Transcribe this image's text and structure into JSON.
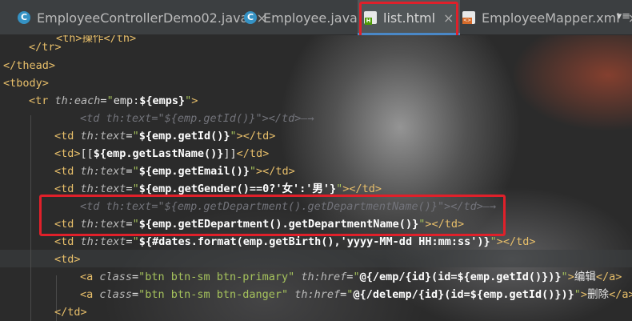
{
  "tabs": [
    {
      "label": "EmployeeControllerDemo02.java",
      "icon": "java-class-icon",
      "closable": true,
      "active": false
    },
    {
      "label": "Employee.java",
      "icon": "java-class-icon",
      "closable": true,
      "active": false
    },
    {
      "label": "list.html",
      "icon": "html-file-icon",
      "closable": true,
      "active": true
    },
    {
      "label": "EmployeeMapper.xml",
      "icon": "xml-file-icon",
      "closable": true,
      "active": false
    }
  ],
  "tab_icon_letter": "C",
  "close_glyph": "×",
  "more_glyph": "▾≡",
  "code": {
    "line_top": "<th>操作</th>",
    "line_tr_close": "</tr>",
    "line_thead_close": "</thead>",
    "line_tbody": "<tbody>",
    "each": {
      "open": "<tr ",
      "attr": "th:each",
      "eq": "=",
      "q1": "\"",
      "val": "emp:",
      "expr": "${emps}",
      "q2": "\"",
      "close": ">"
    },
    "cm_id": "<td th:text=\"${emp.getId()}\"></td>—→",
    "td_id": {
      "open": "<td ",
      "attr": "th:text",
      "eq": "=",
      "q1": "\"",
      "expr": "${emp.getId()}",
      "q2": "\"",
      "close": "></td>"
    },
    "td_last": {
      "open": "<td>",
      "text": "[[",
      "expr": "${emp.getLastName()}",
      "text2": "]]",
      "close": "</td>"
    },
    "td_email": {
      "open": "<td ",
      "attr": "th:text",
      "eq": "=",
      "q1": "\"",
      "expr": "${emp.getEmail()}",
      "q2": "\"",
      "close": "></td>"
    },
    "td_gender": {
      "open": "<td ",
      "attr": "th:text",
      "eq": "=",
      "q1": "\"",
      "expr": "${emp.getGender()==0?'女':'男'}",
      "q2": "\"",
      "close": "></td>"
    },
    "cm_dept": "<td th:text=\"${emp.getDepartment().getDepartmentName()}\"></td>—→",
    "td_dept": {
      "open": "<td ",
      "attr": "th:text",
      "eq": "=",
      "q1": "\"",
      "expr": "${emp.getEDepartment().getDepartmentName()}",
      "q2": "\"",
      "close": "></td>"
    },
    "td_birth": {
      "open": "<td ",
      "attr": "th:text",
      "eq": "=",
      "q1": "\"",
      "expr": "${#dates.format(emp.getBirth(),'yyyy-MM-dd HH:mm:ss')}",
      "q2": "\"",
      "close": "></td>"
    },
    "td_open": "<td>",
    "a_edit": {
      "open": "<a ",
      "cls_attr": "class",
      "eq": "=",
      "cls_val": "\"btn btn-sm btn-primary\"",
      "href_attr": "th:href",
      "eq2": "=",
      "q1": "\"",
      "expr": "@{/emp/{id}(id=${emp.getId()})}",
      "q2": "\"",
      "gt": ">",
      "text": "编辑",
      "close": "</a>"
    },
    "a_del": {
      "open": "<a ",
      "cls_attr": "class",
      "eq": "=",
      "cls_val": "\"btn btn-sm btn-danger\"",
      "href_attr": "th:href",
      "eq2": "=",
      "q1": "\"",
      "expr": "@{/delemp/{id}(id=${emp.getId()})}",
      "q2": "\"",
      "gt": ">",
      "text": "删除",
      "close": "</a>"
    },
    "td_close": "</td>"
  },
  "colors": {
    "highlight_box": "#e0202a",
    "tag": "#e8bf6a",
    "attribute": "#bababa",
    "string": "#a5c25c",
    "comment": "#72737a"
  }
}
